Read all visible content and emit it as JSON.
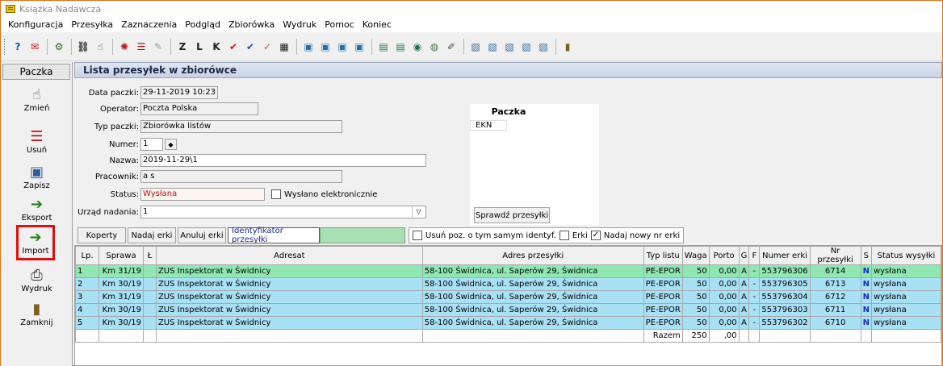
{
  "window": {
    "title": "Książka Nadawcza"
  },
  "menu": [
    "Konfiguracja",
    "Przesyłka",
    "Zaznaczenia",
    "Podgląd",
    "Zbiorówka",
    "Wydruk",
    "Pomoc",
    "Koniec"
  ],
  "sidebar": {
    "header": "Paczka",
    "buttons": [
      "Zmień",
      "Usuń",
      "Zapisz",
      "Eksport",
      "Import",
      "Wydruk",
      "Zamknij"
    ]
  },
  "section_title": "Lista przesyłek w zbiorówce",
  "form": {
    "data_paczki_label": "Data paczki:",
    "data_paczki": "29-11-2019  10:23",
    "operator_label": "Operator:",
    "operator": "Poczta Polska",
    "typ_label": "Typ paczki:",
    "typ": "Zbiorówka listów",
    "numer_label": "Numer:",
    "numer": "1",
    "nazwa_label": "Nazwa:",
    "nazwa": "2019-11-29\\1",
    "pracownik_label": "Pracownik:",
    "pracownik": "a s",
    "status_label": "Status:",
    "status": "Wysłana",
    "wyslano_el_label": "Wysłano elektronicznie",
    "urzad_label": "Urząd nadania:",
    "urzad": "1",
    "paczka_header": "Paczka",
    "paczka_value": "EKN",
    "sprawdz_button": "Sprawdź przesyłki"
  },
  "actions": {
    "koperty": "Koperty",
    "nadaj": "Nadaj erki",
    "anuluj": "Anuluj erki",
    "identyfikator": "Identyfikator przesyłki",
    "usun_poz": "Usuń poz. o tym samym identyf.",
    "erki": "Erki",
    "nadaj_nowy": "Nadaj nowy nr erki"
  },
  "table": {
    "headers": [
      "Lp.",
      "Sprawa",
      "Ł",
      "Adresat",
      "Adres przesyłki",
      "Typ listu",
      "Waga",
      "Porto",
      "G",
      "F",
      "Numer erki",
      "Nr przesyłki",
      "S",
      "Status wysyłki"
    ],
    "rows": [
      [
        "1",
        "Km 31/19",
        "",
        "ZUS Inspektorat w Świdnicy",
        "58-100 Świdnica, ul. Saperów 29, Świdnica",
        "PE-EPOR",
        "50",
        "0,00",
        "A",
        "-",
        "553796306",
        "6714",
        "N",
        "wysłana"
      ],
      [
        "2",
        "Km 30/19",
        "",
        "ZUS Inspektorat w Świdnicy",
        "58-100 Świdnica, ul. Saperów 29, Świdnica",
        "PE-EPOR",
        "50",
        "0,00",
        "A",
        "-",
        "553796305",
        "6713",
        "N",
        "wysłana"
      ],
      [
        "3",
        "Km 31/19",
        "",
        "ZUS Inspektorat w Świdnicy",
        "58-100 Świdnica, ul. Saperów 29, Świdnica",
        "PE-EPOR",
        "50",
        "0,00",
        "A",
        "-",
        "553796304",
        "6712",
        "N",
        "wysłana"
      ],
      [
        "4",
        "Km 30/19",
        "",
        "ZUS Inspektorat w Świdnicy",
        "58-100 Świdnica, ul. Saperów 29, Świdnica",
        "PE-EPOR",
        "50",
        "0,00",
        "A",
        "-",
        "553796303",
        "6711",
        "N",
        "wysłana"
      ],
      [
        "5",
        "Km 30/19",
        "",
        "ZUS Inspektorat w Świdnicy",
        "58-100 Świdnica, ul. Saperów 29, Świdnica",
        "PE-EPOR",
        "50",
        "0,00",
        "A",
        "-",
        "553796302",
        "6710",
        "N",
        "wysłana"
      ]
    ],
    "total_label": "Razem",
    "total_waga": "250",
    "total_porto": ",00"
  }
}
